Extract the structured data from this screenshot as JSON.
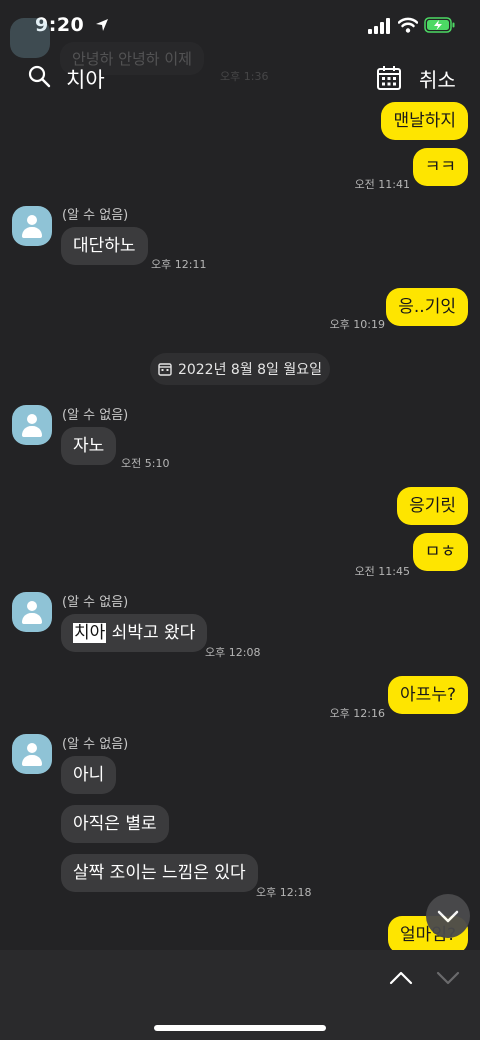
{
  "status": {
    "time": "9:20"
  },
  "ghost": {
    "text": "안녕하 안녕하 이제",
    "time": "오후 1:36"
  },
  "search": {
    "query": "치아",
    "cancel_label": "취소"
  },
  "date_divider": "2022년 8월 8일 월요일",
  "messages": {
    "m1": "맨날하지",
    "m2": "ㅋㅋ",
    "t2": "오전 11:41",
    "s3": "(알 수 없음)",
    "m3": "대단하노",
    "t3": "오후 12:11",
    "m4": "응..기잇",
    "t4": "오후 10:19",
    "s5": "(알 수 없음)",
    "m5": "자노",
    "t5": "오전 5:10",
    "m6": "응기릿",
    "m7": "ㅁㅎ",
    "t7": "오전 11:45",
    "s8": "(알 수 없음)",
    "m8_hl": "치아",
    "m8_rest": " 쇠박고 왔다",
    "t8": "오후 12:08",
    "m9": "아프누?",
    "t9": "오후 12:16",
    "s10": "(알 수 없음)",
    "m10": "아니",
    "m11": "아직은 별로",
    "m12": "살짝 조이는 느낌은 있다",
    "t12": "오후 12:18",
    "m13": "얼마임?"
  }
}
